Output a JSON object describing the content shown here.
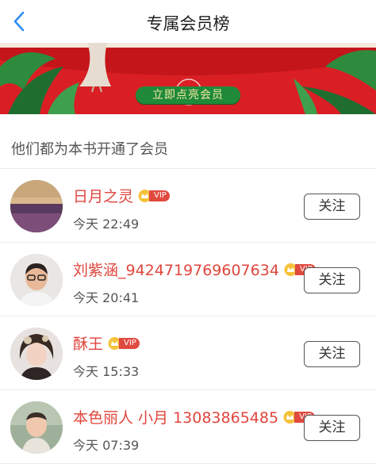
{
  "header": {
    "title": "专属会员榜"
  },
  "banner": {
    "cta_label": "立即点亮会员"
  },
  "section_label": "他们都为本书开通了会员",
  "members": [
    {
      "name": "日月之灵",
      "vip": "VIP",
      "time": "今天 22:49",
      "follow": "关注"
    },
    {
      "name": "刘紫涵_9424719769607634",
      "vip": "VIP",
      "time": "今天 20:41",
      "follow": "关注"
    },
    {
      "name": "酥王",
      "vip": "VIP",
      "time": "今天 15:33",
      "follow": "关注"
    },
    {
      "name": "本色丽人 小月 13083865485",
      "vip": "VIP",
      "time": "今天 07:39",
      "follow": "关注"
    }
  ],
  "colors": {
    "name_red": "#e0463c",
    "banner_red": "#d91f24",
    "cta_green": "#1f8a3a",
    "back_blue": "#2d8cf0"
  }
}
